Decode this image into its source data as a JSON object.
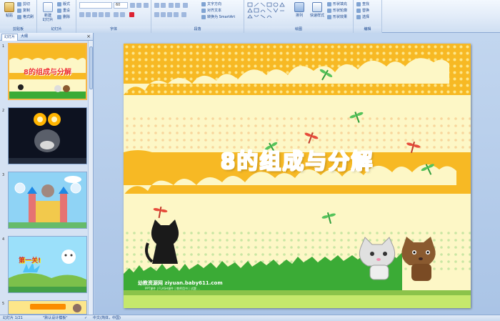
{
  "ribbon": {
    "clipboard": {
      "label": "剪贴板",
      "paste": "粘贴",
      "cut": "剪切",
      "copy": "复制",
      "format_painter": "格式刷"
    },
    "slides": {
      "label": "幻灯片",
      "new_slide_line1": "新建",
      "new_slide_line2": "幻灯片",
      "layout": "版式",
      "reset": "重设",
      "delete": "删除"
    },
    "font": {
      "label": "字体",
      "font_name": "",
      "font_size": "60"
    },
    "paragraph": {
      "label": "段落",
      "text_direction": "文字方向",
      "align_text": "对齐文本",
      "convert_smartart": "转换为 SmartArt"
    },
    "drawing": {
      "label": "绘图",
      "arrange": "排列",
      "quick_styles": "快速样式",
      "shape_fill": "形状填充",
      "shape_outline": "形状轮廓",
      "shape_effects": "形状效果"
    },
    "editing": {
      "label": "编辑",
      "find": "查找",
      "replace": "替换",
      "select": "选择"
    }
  },
  "left_panel": {
    "tab_slides": "幻灯片",
    "tab_outline": "大纲",
    "close": "×",
    "thumbnails": [
      {
        "num": "1",
        "title": "8的组成与分解"
      },
      {
        "num": "2"
      },
      {
        "num": "3"
      },
      {
        "num": "4",
        "title": "第一关!"
      },
      {
        "num": "5"
      }
    ]
  },
  "slide": {
    "title": "8的组成与分解",
    "watermark": "幼教资源网 ziyuan.baby611.com",
    "watermark_sub": "PPT课件 | FLASH课件 | 教师用书 | 试题 ..."
  },
  "status": {
    "slide_indicator": "幻灯片 1/21",
    "theme": "\"默认设计模板\"",
    "language": "中文(简体，中国)"
  },
  "colors": {
    "ribbon_bg": "#dbe7f6",
    "accent_border": "#8ba9d3",
    "selected_thumb": "#f6b64a",
    "slide_orange": "#f7b924",
    "slide_cream": "#fdf7c6",
    "grass": "#3bab36"
  },
  "icons": [
    "paste-icon",
    "cut-icon",
    "copy-icon",
    "format-painter-icon",
    "new-slide-icon",
    "arrange-icon",
    "quick-styles-icon",
    "find-icon",
    "replace-icon",
    "select-icon",
    "dragonfly-icon",
    "cat-icon"
  ]
}
